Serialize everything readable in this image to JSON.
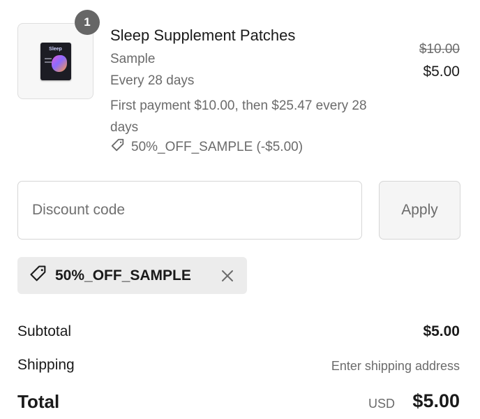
{
  "line_item": {
    "quantity_badge": "1",
    "title": "Sleep Supplement Patches",
    "variant": "Sample",
    "interval": "Every 28 days",
    "payment_terms": "First payment $10.00, then $25.47 every 28 days",
    "discount_label": "50%_OFF_SAMPLE (-$5.00)",
    "original_price": "$10.00",
    "price": "$5.00",
    "thumbnail_label": "Sleep"
  },
  "discount": {
    "placeholder": "Discount code",
    "apply_label": "Apply",
    "applied_code": "50%_OFF_SAMPLE"
  },
  "summary": {
    "subtotal_label": "Subtotal",
    "subtotal_value": "$5.00",
    "shipping_label": "Shipping",
    "shipping_value": "Enter shipping address",
    "total_label": "Total",
    "currency": "USD",
    "total_value": "$5.00"
  },
  "icons": {
    "tag": "tag-icon",
    "close": "close-icon"
  },
  "colors": {
    "badge": "#666666",
    "muted_text": "#6b6b6b",
    "tag_background": "#ececec"
  }
}
